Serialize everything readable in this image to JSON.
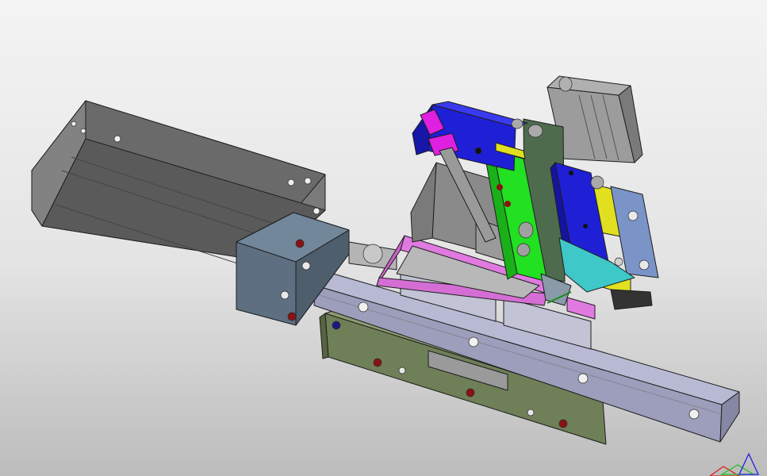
{
  "viewport": {
    "background_top": "#f4f4f4",
    "background_bottom": "#bcbcbc"
  },
  "colors": {
    "cylinder_body": "#6f6f6f",
    "end_cap": "#5d6f80",
    "base_plate": "#7a8a62",
    "rail": "#a8aac4",
    "magenta_frame": "#e07ae0",
    "blue_block": "#1f1fd6",
    "green_plate": "#22e022",
    "yellow_block": "#e0e020",
    "cyan_block": "#3ec8c8",
    "steel_blue_block": "#7b94c8",
    "hole_red": "#8b1212"
  },
  "axis_triad": {
    "x_color": "#e02020",
    "y_color": "#20c020",
    "z_color": "#2020e0"
  }
}
